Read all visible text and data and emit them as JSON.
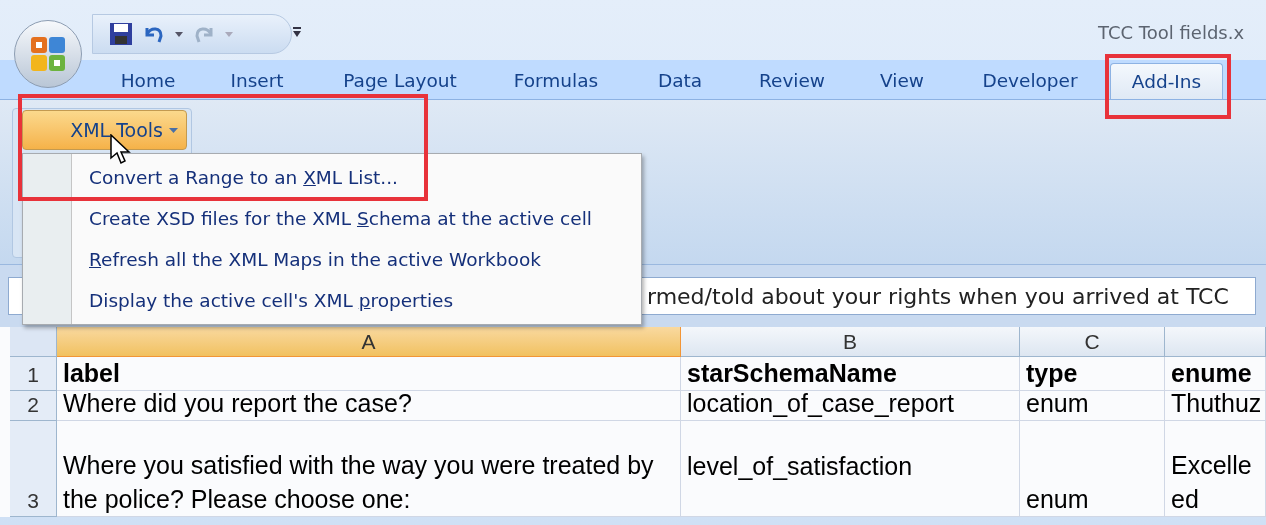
{
  "window": {
    "title": "TCC Tool fields.x"
  },
  "tabs": [
    {
      "label": "Home",
      "selected": false
    },
    {
      "label": "Insert",
      "selected": false
    },
    {
      "label": "Page Layout",
      "selected": false
    },
    {
      "label": "Formulas",
      "selected": false
    },
    {
      "label": "Data",
      "selected": false
    },
    {
      "label": "Review",
      "selected": false
    },
    {
      "label": "View",
      "selected": false
    },
    {
      "label": "Developer",
      "selected": false
    },
    {
      "label": "Add-Ins",
      "selected": true
    }
  ],
  "ribbon": {
    "button": {
      "label": "XML Tools",
      "expanded": true
    }
  },
  "menu": {
    "items": [
      {
        "before": "Convert a Range to an ",
        "key": "X",
        "after": "ML List..."
      },
      {
        "before": "Create XSD files for the XML ",
        "key": "S",
        "after": "chema at the active cell"
      },
      {
        "key": "R",
        "after": "efresh all the XML Maps in the active Workbook"
      },
      {
        "before": "Display the active cell's XML ",
        "key": "p",
        "after": "roperties"
      }
    ]
  },
  "formula_bar": {
    "value": "rmed/told about your rights when you arrived at TCC"
  },
  "sheet": {
    "columns": [
      {
        "label": "A",
        "selected": true
      },
      {
        "label": "B",
        "selected": false
      },
      {
        "label": "C",
        "selected": false
      },
      {
        "selected": false
      }
    ],
    "rows": [
      {
        "number": "1",
        "cells": [
          {
            "lines": [
              "label"
            ],
            "bold": true
          },
          {
            "lines": [
              "starSchemaName"
            ],
            "bold": true
          },
          {
            "lines": [
              "type"
            ],
            "bold": true
          },
          {
            "lines": [
              "enume"
            ],
            "bold": true
          }
        ]
      },
      {
        "number": "2",
        "cells": [
          {
            "lines": [
              "Where did you report the case?"
            ],
            "bold": false
          },
          {
            "lines": [
              "location_of_case_report"
            ],
            "bold": false
          },
          {
            "lines": [
              "enum"
            ],
            "bold": false
          },
          {
            "lines": [
              "Thuthuz"
            ],
            "bold": false
          }
        ]
      },
      {
        "number": "3",
        "cells": [
          {
            "lines": [
              "Where you satisfied with the way you were treated by",
              "the police? Please choose one:"
            ],
            "bold": false
          },
          {
            "lines": [
              "level_of_satisfaction"
            ],
            "bold": false,
            "top_aligned": true
          },
          {
            "lines": [
              "enum"
            ],
            "bold": false
          },
          {
            "lines": [
              "Excelle",
              "ed"
            ],
            "bold": false
          }
        ]
      }
    ]
  }
}
